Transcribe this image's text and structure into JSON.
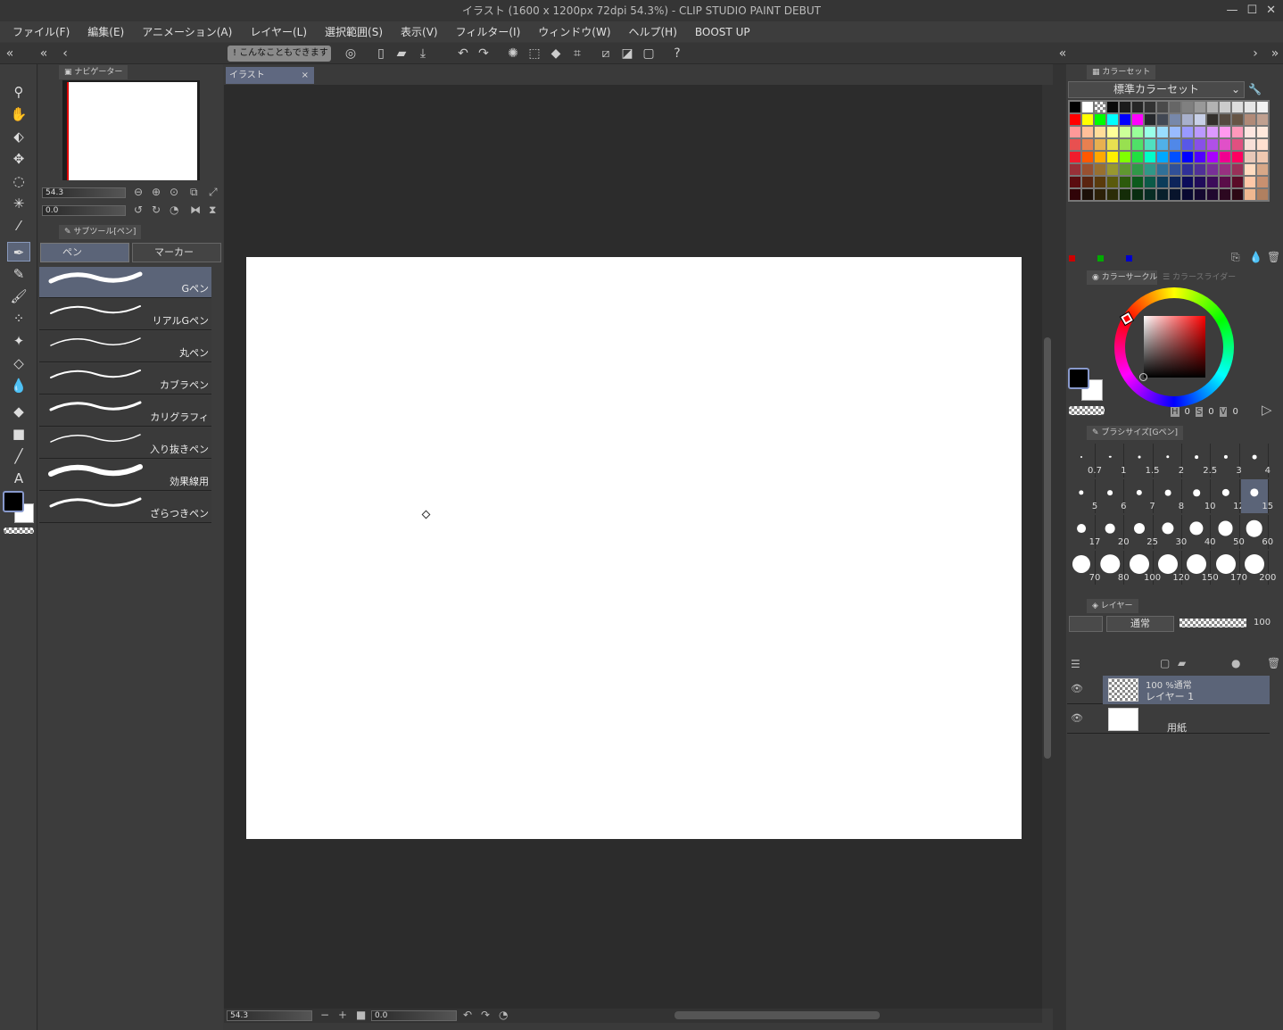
{
  "window": {
    "title": "イラスト (1600 x 1200px 72dpi 54.3%) - CLIP STUDIO PAINT DEBUT",
    "controls": [
      "minimize",
      "maximize",
      "close"
    ]
  },
  "menu": [
    "ファイル(F)",
    "編集(E)",
    "アニメーション(A)",
    "レイヤー(L)",
    "選択範囲(S)",
    "表示(V)",
    "フィルター(I)",
    "ウィンドウ(W)",
    "ヘルプ(H)",
    "BOOST UP"
  ],
  "toolbar": {
    "tip_button": "こんなこともできます"
  },
  "document_tab": {
    "label": "イラスト",
    "close": "×"
  },
  "navigator": {
    "tab": "ナビゲーター",
    "zoom": "54.3",
    "rotation": "0.0"
  },
  "subtool": {
    "tab": "サブツール[ペン]",
    "groups": [
      "ペン",
      "マーカー"
    ],
    "selected_group": "ペン",
    "brushes": [
      "Gペン",
      "リアルGペン",
      "丸ペン",
      "カブラペン",
      "カリグラフィ",
      "入り抜きペン",
      "効果線用",
      "ざらつきペン"
    ],
    "selected": "Gペン"
  },
  "statusbar": {
    "zoom": "54.3",
    "rotation": "0.0"
  },
  "colorset": {
    "tab": "カラーセット",
    "selected": "標準カラーセット",
    "rows": [
      [
        "#000000",
        "#ffffff",
        "checker",
        "#0a0a0a",
        "#1a1a1a",
        "#262626",
        "#333333",
        "#4a4a4a",
        "#666666",
        "#808080",
        "#999999",
        "#b3b3b3",
        "#cccccc",
        "#dddddd",
        "#e6e6e6",
        "#f2f2f2"
      ],
      [
        "#ff0000",
        "#ffff00",
        "#00ff00",
        "#00ffff",
        "#0000ff",
        "#ff00ff",
        "#26282c",
        "#424854",
        "#7788aa",
        "#a8b0cc",
        "#c8d0e8",
        "#33302c",
        "#554a40",
        "#665545",
        "#b08a78",
        "#c0a090"
      ],
      [
        "#ff9999",
        "#ffc099",
        "#ffdd99",
        "#ffff99",
        "#ccff99",
        "#99ff99",
        "#99ffe8",
        "#99ddff",
        "#99bbff",
        "#9999ff",
        "#bb99ff",
        "#dd99ff",
        "#ff99ee",
        "#ff99bb",
        "#fde6e0",
        "#ffe8dc"
      ],
      [
        "#e85050",
        "#e88050",
        "#e8b050",
        "#e8e050",
        "#98e050",
        "#50e068",
        "#50e0c0",
        "#50b0e8",
        "#5088e8",
        "#5858e8",
        "#8850e8",
        "#b050e8",
        "#e050c8",
        "#e05080",
        "#f8e0d8",
        "#ffe0d0"
      ],
      [
        "#f01c2c",
        "#ff5800",
        "#ffa800",
        "#fff000",
        "#80ff00",
        "#20e040",
        "#00ffc8",
        "#00a8ff",
        "#0050ff",
        "#0000ff",
        "#5000ff",
        "#a800ff",
        "#f00090",
        "#ff0060",
        "#e8c8b8",
        "#f0c8b0"
      ],
      [
        "#983038",
        "#985030",
        "#987030",
        "#989830",
        "#609830",
        "#309848",
        "#309888",
        "#307098",
        "#305098",
        "#303098",
        "#503098",
        "#783098",
        "#983080",
        "#983058",
        "#ffdcc0",
        "#d8a888"
      ],
      [
        "#5a0c10",
        "#5a2410",
        "#5a3a0c",
        "#5a5a0c",
        "#2c5a0c",
        "#0c5a1c",
        "#0c5a48",
        "#0c3c5a",
        "#0c245a",
        "#0c0c5a",
        "#200c5a",
        "#3c0c5a",
        "#5a0c48",
        "#5a0c28",
        "#ffc8a8",
        "#c89070"
      ],
      [
        "#300408",
        "#1c1008",
        "#2c2008",
        "#2c2c08",
        "#142c08",
        "#082c10",
        "#082c24",
        "#08202c",
        "#08142c",
        "#080830",
        "#140830",
        "#200830",
        "#2c0820",
        "#2c0814",
        "#f0b890",
        "#b08060"
      ]
    ],
    "history": [
      "#cc0000",
      "#00aa00",
      "#0000cc"
    ]
  },
  "colorcircle": {
    "tabs": [
      "カラーサークル",
      "カラースライダー"
    ],
    "h_label": "H",
    "h": "0",
    "s_label": "S",
    "s": "0",
    "v_label": "V",
    "v": "0",
    "main_color": "#000000",
    "sub_color": "#ffffff"
  },
  "brushsize": {
    "tab": "ブラシサイズ[Gペン]",
    "sizes": [
      "0.7",
      "1",
      "1.5",
      "2",
      "2.5",
      "3",
      "4",
      "5",
      "6",
      "7",
      "8",
      "10",
      "12",
      "15",
      "17",
      "20",
      "25",
      "30",
      "40",
      "50",
      "60",
      "70",
      "80",
      "100",
      "120",
      "150",
      "170",
      "200"
    ],
    "selected": "15"
  },
  "layers": {
    "tab": "レイヤー",
    "blend_mode": "通常",
    "opacity": "100",
    "items": [
      {
        "line1": "100 %通常",
        "line2": "レイヤー 1",
        "selected": true
      },
      {
        "line1": "",
        "line2": "用紙",
        "selected": false
      }
    ]
  },
  "accent": "#5b6478"
}
